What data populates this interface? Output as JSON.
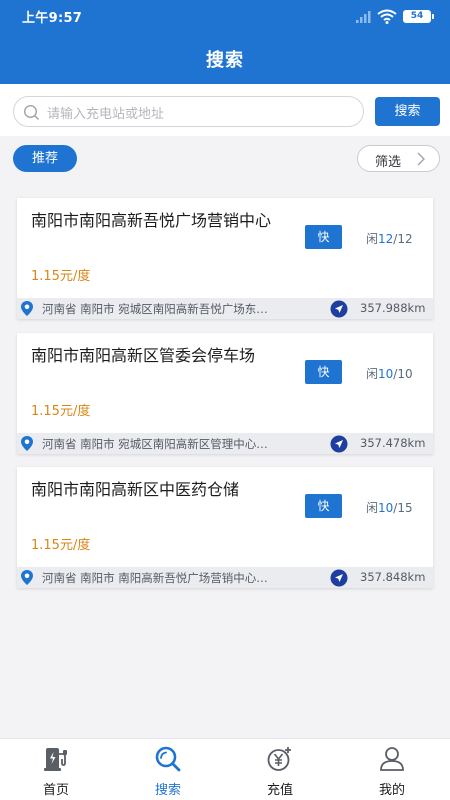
{
  "status_bar": {
    "time": "上午9:57",
    "battery": "54"
  },
  "header": {
    "title": "搜索"
  },
  "search": {
    "placeholder": "请输入充电站或地址",
    "button_label": "搜索"
  },
  "filters": {
    "recommend_label": "推荐",
    "filter_label": "筛选"
  },
  "stations": [
    {
      "name": "南阳市南阳高新吾悦广场营销中心",
      "badge": "快",
      "idle_label": "闲",
      "idle": "12",
      "total": "/12",
      "price": "1.15元/度",
      "address": "河南省 南阳市 宛城区南阳高新吾悦广场东…",
      "distance": "357.988km"
    },
    {
      "name": "南阳市南阳高新区管委会停车场",
      "badge": "快",
      "idle_label": "闲",
      "idle": "10",
      "total": "/10",
      "price": "1.15元/度",
      "address": "河南省 南阳市  宛城区南阳高新区管理中心…",
      "distance": "357.478km"
    },
    {
      "name": "南阳市南阳高新区中医药仓储",
      "badge": "快",
      "idle_label": "闲",
      "idle": "10",
      "total": "/15",
      "price": "1.15元/度",
      "address": "河南省 南阳市 南阳高新吾悦广场营销中心…",
      "distance": "357.848km"
    }
  ],
  "tabbar": {
    "items": [
      {
        "label": "首页",
        "icon": "charger-icon"
      },
      {
        "label": "搜索",
        "icon": "search-icon"
      },
      {
        "label": "充值",
        "icon": "recharge-icon"
      },
      {
        "label": "我的",
        "icon": "user-icon"
      }
    ],
    "active_index": 1
  },
  "colors": {
    "primary": "#1f74d2",
    "price": "#d88717",
    "background": "#f3f3f5"
  }
}
